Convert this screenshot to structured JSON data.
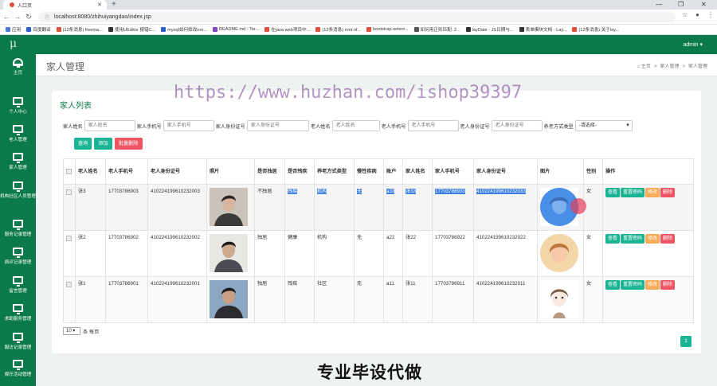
{
  "browser": {
    "tab_title": "入口页",
    "url": "localhost:8080/zhihuiyangdao/index.jsp",
    "bookmarks": [
      {
        "label": "应用",
        "color": "#4a7bd9"
      },
      {
        "label": "百度翻译",
        "color": "#2a62c9"
      },
      {
        "label": "(12条消息) freema...",
        "color": "#e0503d"
      },
      {
        "label": "使用UEditor 报错C...",
        "color": "#333333"
      },
      {
        "label": "mysql如何修改roo...",
        "color": "#2a62c9"
      },
      {
        "label": "README.md - Ter...",
        "color": "#7a49c9"
      },
      {
        "label": "在java web项目中...",
        "color": "#e0503d"
      },
      {
        "label": "(12条消息) root of...",
        "color": "#e0503d"
      },
      {
        "label": "bootstrap-select...",
        "color": "#e0503d"
      },
      {
        "label": "如何用正则匹配: 2...",
        "color": "#555555"
      },
      {
        "label": "layDate - JS日期与...",
        "color": "#333333"
      },
      {
        "label": "表单模块文档 - Lay...",
        "color": "#333333"
      },
      {
        "label": "(12条消息) 关于lay...",
        "color": "#e0503d"
      }
    ]
  },
  "header": {
    "logo": "μ",
    "user": "admin ▾"
  },
  "sidebar": {
    "items": [
      {
        "label": "主页"
      },
      {
        "label": "个人中心"
      },
      {
        "label": "老人管理"
      },
      {
        "label": "家人管理"
      },
      {
        "label": "机构社区人员管理"
      },
      {
        "label": "服务记录管理"
      },
      {
        "label": "病评记录管理"
      },
      {
        "label": "留言管理"
      },
      {
        "label": "求助服务管理"
      },
      {
        "label": "服访记录管理"
      },
      {
        "label": "娱乐活动管理"
      }
    ]
  },
  "page": {
    "title": "家人管理",
    "breadcrumb": [
      "⌂ 主页",
      ">",
      "家人管理",
      ">",
      "家人管理"
    ]
  },
  "watermark": "https://www.huzhan.com/ishop39397",
  "footer_watermark": "专业毕设代做",
  "panel": {
    "title": "家人列表",
    "filters": [
      {
        "label": "家人姓名",
        "placeholder": "家人姓名"
      },
      {
        "label": "家人手机号",
        "placeholder": "家人手机号"
      },
      {
        "label": "家人身份证号",
        "placeholder": "家人身份证号"
      },
      {
        "label": "老人姓名",
        "placeholder": "老人姓名"
      },
      {
        "label": "老人手机号",
        "placeholder": "老人手机号"
      },
      {
        "label": "老人身份证号",
        "placeholder": "老人身份证号"
      }
    ],
    "select": {
      "label": "养老方式类型",
      "value": "-请选择-"
    },
    "buttons": {
      "search": "查询",
      "add": "添加",
      "batch_delete": "批量删除"
    },
    "columns": [
      "",
      "老人姓名",
      "老人手机号",
      "老人身份证号",
      "照片",
      "是否独居",
      "是否残疾",
      "养老方式类型",
      "慢性疾病",
      "账户",
      "家人姓名",
      "家人手机号",
      "家人身份证号",
      "图片",
      "性别",
      "操作"
    ],
    "rows": [
      {
        "name": "张3",
        "phone": "17703786903",
        "idcard": "410224199610232003",
        "alone": "不独居",
        "disabled": "残疾",
        "mode": "机构",
        "disease": "无",
        "account": "a33",
        "fname": "张33",
        "fphone": "17703786933",
        "fidcard": "410224199610232033",
        "gender": "女"
      },
      {
        "name": "张2",
        "phone": "17703786902",
        "idcard": "410224199610232002",
        "alone": "独居",
        "disabled": "健康",
        "mode": "机构",
        "disease": "无",
        "account": "a22",
        "fname": "张22",
        "fphone": "17703786922",
        "fidcard": "410224199610232022",
        "gender": "女"
      },
      {
        "name": "张1",
        "phone": "17703786901",
        "idcard": "410224199610232001",
        "alone": "独居",
        "disabled": "残疾",
        "mode": "社区",
        "disease": "无",
        "account": "a11",
        "fname": "张11",
        "fphone": "17703786911",
        "fidcard": "410224199610232011",
        "gender": "女"
      }
    ],
    "actions": {
      "view": "查看",
      "reset": "重置密码",
      "edit": "修改",
      "delete": "删除"
    },
    "pager": {
      "page_size": "10",
      "per_page_label": "条 每页",
      "current_page": "1"
    }
  },
  "colors": {
    "brand": "#0b7a4a",
    "primary": "#1ab394",
    "danger": "#ed5565",
    "warning": "#f8ac59"
  }
}
